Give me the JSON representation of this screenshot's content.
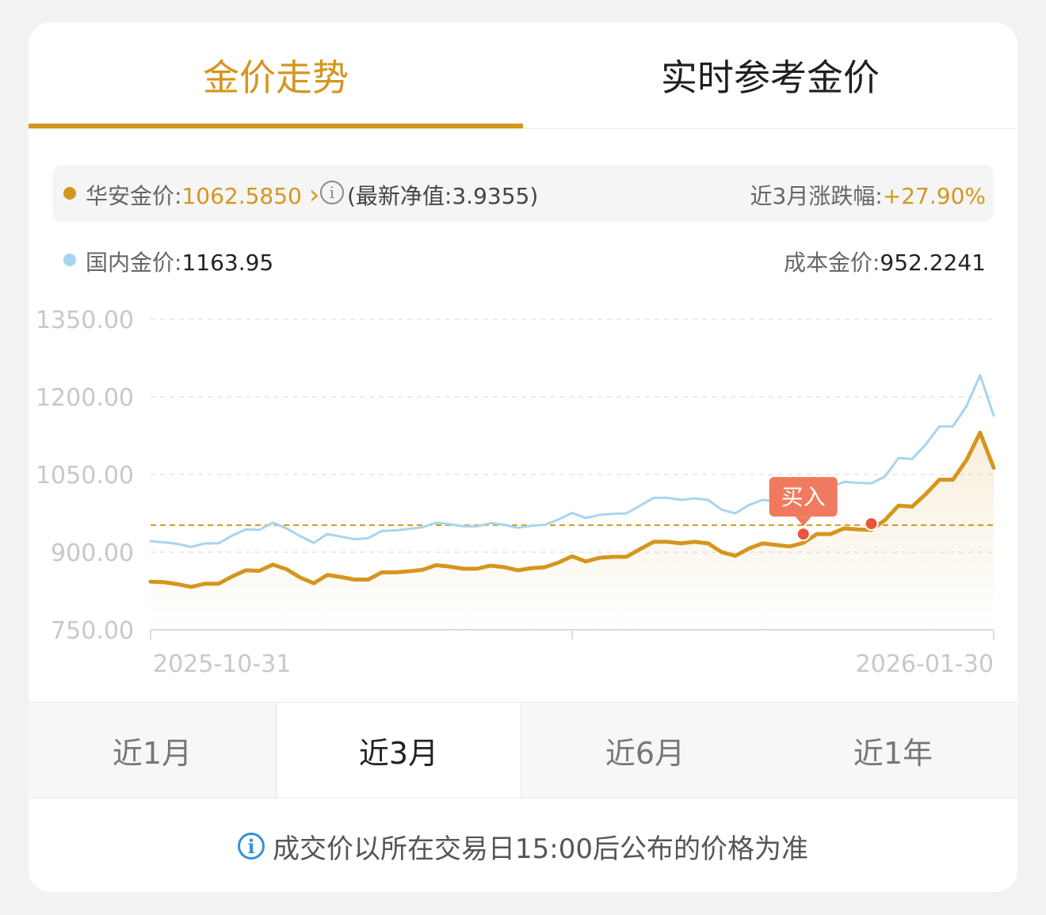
{
  "tabs": [
    {
      "label": "金价走势",
      "active": true
    },
    {
      "label": "实时参考金价",
      "active": false
    }
  ],
  "summary": {
    "huaan_label": "华安金价:",
    "huaan_value": "1062.5850",
    "chevron": "›",
    "info_icon": "info-icon",
    "nav_text": "(最新净值:3.9355)",
    "change_label": "近3月涨跌幅:",
    "change_value": "+27.90%",
    "domestic_label": "国内金价:",
    "domestic_value": "1163.95",
    "cost_label": "成本金价:",
    "cost_value": "952.2241"
  },
  "colors": {
    "accent": "#d4961f",
    "domestic_line": "#a8d4ef",
    "buy_marker": "#e8563f",
    "buy_tag": "#f07a5f"
  },
  "chart_data": {
    "type": "line",
    "x_start_label": "2025-10-31",
    "x_end_label": "2026-01-30",
    "y_ticks": [
      "1350.00",
      "1200.00",
      "1050.00",
      "900.00",
      "750.00"
    ],
    "ylim": [
      750,
      1350
    ],
    "cost_line": 952.2241,
    "buy_label": "买入",
    "buy_points": [
      {
        "index": 48,
        "value": 935
      },
      {
        "index": 53,
        "value": 955
      }
    ],
    "series": [
      {
        "name": "华安金价",
        "values": [
          843,
          842,
          838,
          833,
          839,
          839,
          853,
          865,
          864,
          876,
          867,
          851,
          840,
          856,
          852,
          847,
          847,
          861,
          861,
          863,
          866,
          875,
          872,
          868,
          868,
          874,
          871,
          865,
          869,
          871,
          880,
          892,
          882,
          889,
          891,
          891,
          906,
          920,
          920,
          917,
          920,
          917,
          900,
          893,
          907,
          917,
          914,
          911,
          918,
          935,
          935,
          946,
          944,
          943,
          962,
          990,
          988,
          1012,
          1040,
          1040,
          1078,
          1131,
          1063
        ]
      },
      {
        "name": "国内金价",
        "values": [
          921,
          919,
          916,
          910,
          917,
          917,
          932,
          944,
          943,
          957,
          946,
          931,
          918,
          935,
          930,
          925,
          927,
          941,
          942,
          945,
          948,
          957,
          954,
          950,
          950,
          956,
          953,
          947,
          951,
          953,
          963,
          976,
          966,
          972,
          974,
          975,
          990,
          1005,
          1005,
          1001,
          1004,
          1001,
          982,
          975,
          991,
          1001,
          998,
          996,
          1004,
          1022,
          1025,
          1036,
          1034,
          1033,
          1046,
          1082,
          1080,
          1108,
          1143,
          1143,
          1182,
          1242,
          1164
        ]
      }
    ]
  },
  "periods": [
    {
      "label": "近1月",
      "active": false
    },
    {
      "label": "近3月",
      "active": true
    },
    {
      "label": "近6月",
      "active": false
    },
    {
      "label": "近1年",
      "active": false
    }
  ],
  "footer": {
    "icon": "info-icon",
    "text": "成交价以所在交易日15:00后公布的价格为准"
  }
}
